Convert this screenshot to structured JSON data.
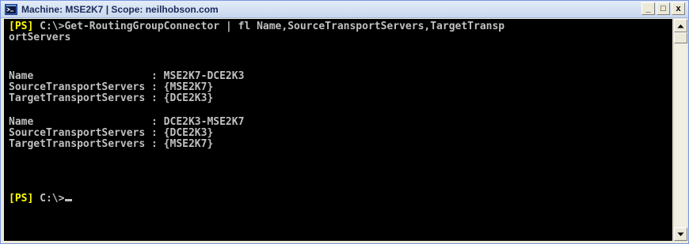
{
  "window": {
    "title": "Machine: MSE2K7 | Scope: neilhobson.com",
    "minimize_label": "_",
    "restore_label": "□",
    "close_label": "x",
    "app_icon": "powershell-console-icon"
  },
  "console": {
    "prompt_tag": "[PS]",
    "command_line1": " C:\\>Get-RoutingGroupConnector | fl Name,SourceTransportServers,TargetTransp",
    "command_line2": "ortServers",
    "records": [
      {
        "name_line": "Name                   : MSE2K7-DCE2K3",
        "source_line": "SourceTransportServers : {MSE2K7}",
        "target_line": "TargetTransportServers : {DCE2K3}"
      },
      {
        "name_line": "Name                   : DCE2K3-MSE2K7",
        "source_line": "SourceTransportServers : {DCE2K3}",
        "target_line": "TargetTransportServers : {MSE2K7}"
      }
    ],
    "final_prompt_path": " C:\\>"
  },
  "colors": {
    "console_background": "#000000",
    "console_text": "#c0c0c0",
    "prompt_tag": "#ffff00"
  }
}
